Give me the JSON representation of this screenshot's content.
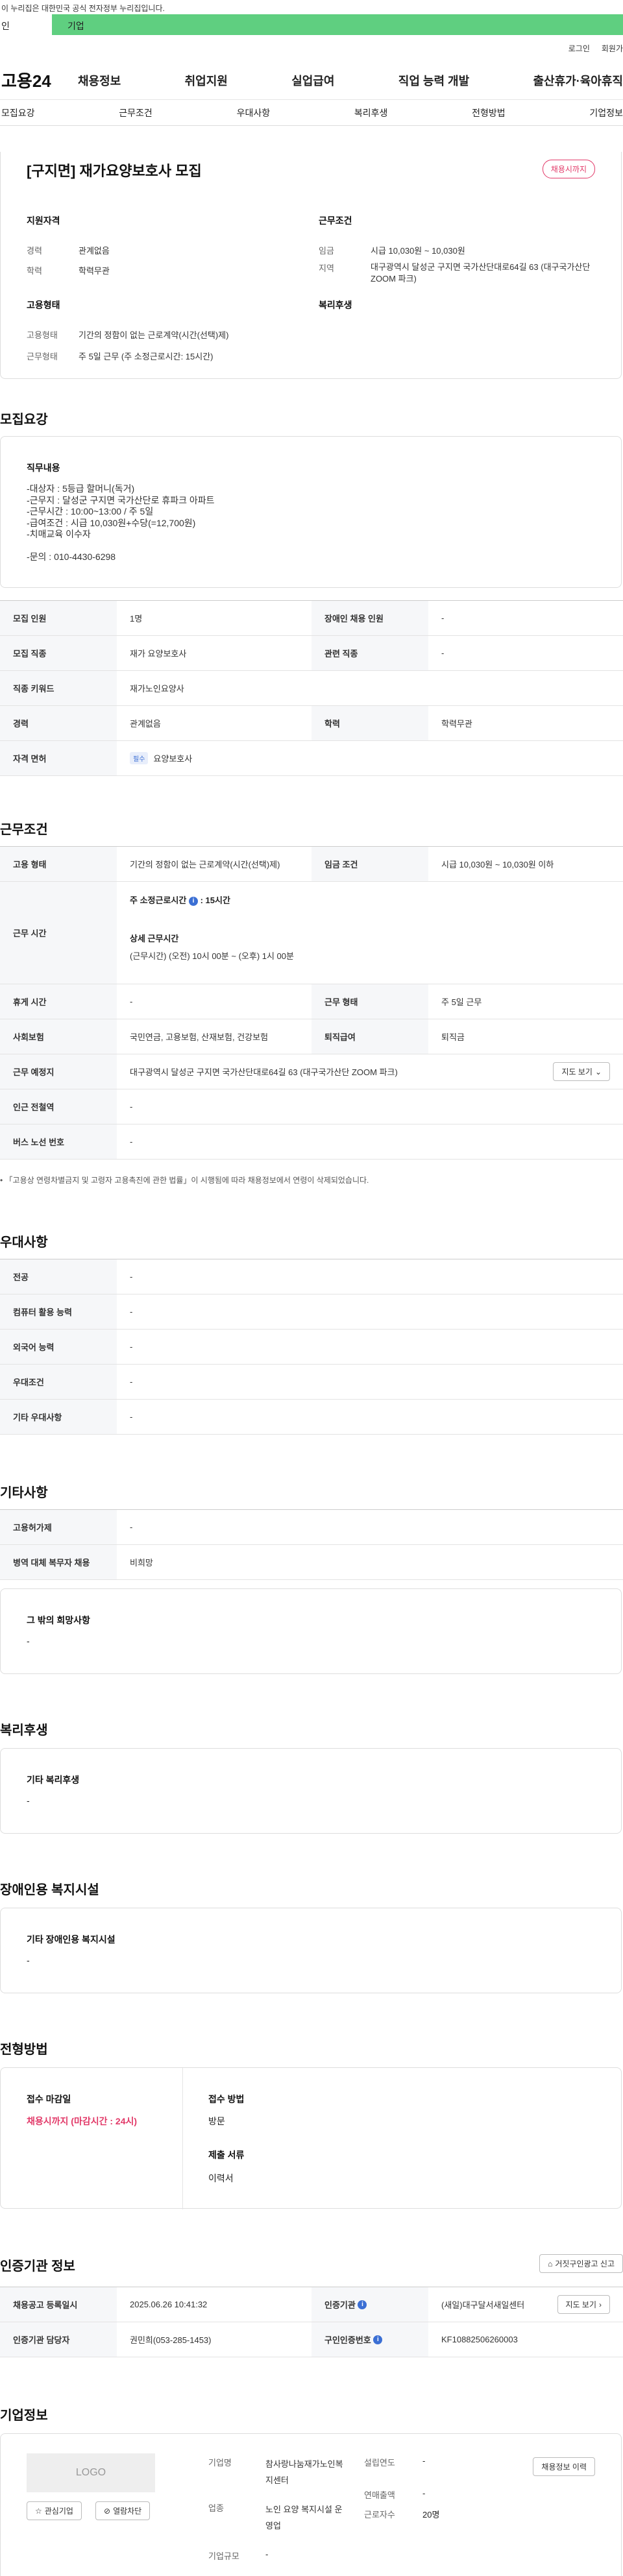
{
  "topbar": {
    "notice": "이 누리집은 대한민국 공식 전자정부 누리집입니다."
  },
  "greenbar": {
    "left": "인",
    "right": "기업"
  },
  "util": {
    "login": "로그인",
    "join": "회원가"
  },
  "gnb": {
    "logo": "고용24",
    "menu": [
      "채용정보",
      "취업지원",
      "실업급여",
      "직업 능력 개발",
      "출산휴가·육아휴직"
    ]
  },
  "anchor": [
    "모집요강",
    "근무조건",
    "우대사항",
    "복리후생",
    "전형방법",
    "기업정보"
  ],
  "summary": {
    "title": "[구지면] 재가요양보호사 모집",
    "badge": "채용시까지",
    "qual_title": "지원자격",
    "career_k": "경력",
    "career_v": "관계없음",
    "edu_k": "학력",
    "edu_v": "학력무관",
    "cond_title": "근무조건",
    "wage_k": "임금",
    "wage_v": "시급 10,030원 ~ 10,030원",
    "region_k": "지역",
    "region_v": "대구광역시 달성군 구지면 국가산단대로64길 63 (대구국가산단 ZOOM 파크)",
    "emp_title": "고용형태",
    "emp_k": "고용형태",
    "emp_v": "기간의 정함이 없는 근로계약(시간(선택)제)",
    "work_k": "근무형태",
    "work_v": "주 5일 근무 (주 소정근로시간: 15시간)",
    "welfare_title": "복리후생"
  },
  "recruit": {
    "title": "모집요강",
    "duty_title": "직무내용",
    "duty_lines": [
      "-대상자 : 5등급 할머니(독거)",
      "-근무지 : 달성군 구지면 국가산단로 휴파크 아파트",
      "-근무시간 : 10:00~13:00 / 주 5일",
      "-급여조건 : 시급 10,030원+수당(=12,700원)",
      "-치매교육 이수자",
      "",
      "-문의 : 010-4430-6298"
    ],
    "rows": [
      {
        "k1": "모집 인원",
        "v1": "1명",
        "k2": "장애인 채용 인원",
        "v2": "-"
      },
      {
        "k1": "모집 직종",
        "v1": "재가 요양보호사",
        "k2": "관련 직종",
        "v2": "-"
      },
      {
        "k1": "직종 키워드",
        "v1": "재가노인요양사"
      },
      {
        "k1": "경력",
        "v1": "관계없음",
        "k2": "학력",
        "v2": "학력무관"
      },
      {
        "k1": "자격 면허",
        "tag": "필수",
        "v1": "요양보호사"
      }
    ]
  },
  "conditions": {
    "title": "근무조건",
    "emp_k": "고용 형태",
    "emp_v": "기간의 정함이 없는 근로계약(시간(선택)제)",
    "wage_k": "임금 조건",
    "wage_v": "시급 10,030원 ~ 10,030원 이하",
    "time_k": "근무 시간",
    "weekly_label": "주 소정근로시간",
    "weekly_v": ": 15시간",
    "detail_title": "상세 근무시간",
    "detail_v": "(근무시간) (오전) 10시 00분 ~ (오후) 1시 00분",
    "rest_k": "휴게 시간",
    "rest_v": "-",
    "form_k": "근무 형태",
    "form_v": "주 5일 근무",
    "ins_k": "사회보험",
    "ins_v": "국민연금, 고용보험, 산재보험, 건강보험",
    "ret_k": "퇴직급여",
    "ret_v": "퇴직금",
    "place_k": "근무 예정지",
    "place_v": "대구광역시 달성군 구지면 국가산단대로64길 63 (대구국가산단 ZOOM 파크)",
    "map_btn": "지도 보기",
    "subway_k": "인근 전철역",
    "subway_v": "-",
    "bus_k": "버스 노선 번호",
    "bus_v": "-",
    "footnote": "「고용상 연령차별금지 및 고령자 고용촉진에 관한 법률」이 시행됨에 따라 채용정보에서 연령이 삭제되었습니다."
  },
  "pref": {
    "title": "우대사항",
    "rows": [
      {
        "k": "전공",
        "v": "-"
      },
      {
        "k": "컴퓨터 활용 능력",
        "v": "-"
      },
      {
        "k": "외국어 능력",
        "v": "-"
      },
      {
        "k": "우대조건",
        "v": "-"
      },
      {
        "k": "기타 우대사항",
        "v": "-"
      }
    ]
  },
  "etc": {
    "title": "기타사항",
    "rows": [
      {
        "k": "고용허가제",
        "v": "-"
      },
      {
        "k": "병역 대체 복무자 채용",
        "v": "비희망"
      }
    ],
    "other_title": "그 밖의 희망사항",
    "other_v": "-"
  },
  "welfare": {
    "title": "복리후생",
    "box_title": "기타 복리후생",
    "box_v": "-"
  },
  "disabled": {
    "title": "장애인용 복지시설",
    "box_title": "기타 장애인용 복지시설",
    "box_v": "-"
  },
  "screening": {
    "title": "전형방법",
    "deadline_title": "접수 마감일",
    "deadline_v": "채용시까지 (마감시간 : 24시)",
    "method_title": "접수 방법",
    "method_v": "방문",
    "docs_title": "제출 서류",
    "docs_v": "이력서"
  },
  "agency": {
    "title": "인증기관 정보",
    "report_btn": "거짓구인광고 신고",
    "reg_k": "채용공고 등록일시",
    "reg_v": "2025.06.26 10:41:32",
    "org_k": "인증기관",
    "org_v": "(새일)대구달서새일센터",
    "map_btn": "지도 보기",
    "mgr_k": "인증기관 담당자",
    "mgr_v": "권민희(053-285-1453)",
    "num_k": "구인인증번호",
    "num_v": "KF10882506260003"
  },
  "company": {
    "title": "기업정보",
    "logo": "LOGO",
    "fav_btn": "관심기업",
    "block_btn": "열람차단",
    "name_k": "기업명",
    "name_v": "참사랑나눔재가노인복지센터",
    "year_k": "설립연도",
    "year_v": "-",
    "hist_btn": "채용정보 이력",
    "biz_k": "업종",
    "biz_v": "노인 요양 복지시설 운영업",
    "sales_k": "연매출액",
    "sales_v": "-",
    "emp_k": "근로자수",
    "emp_v": "20명",
    "size_k": "기업규모",
    "size_v": "-"
  }
}
